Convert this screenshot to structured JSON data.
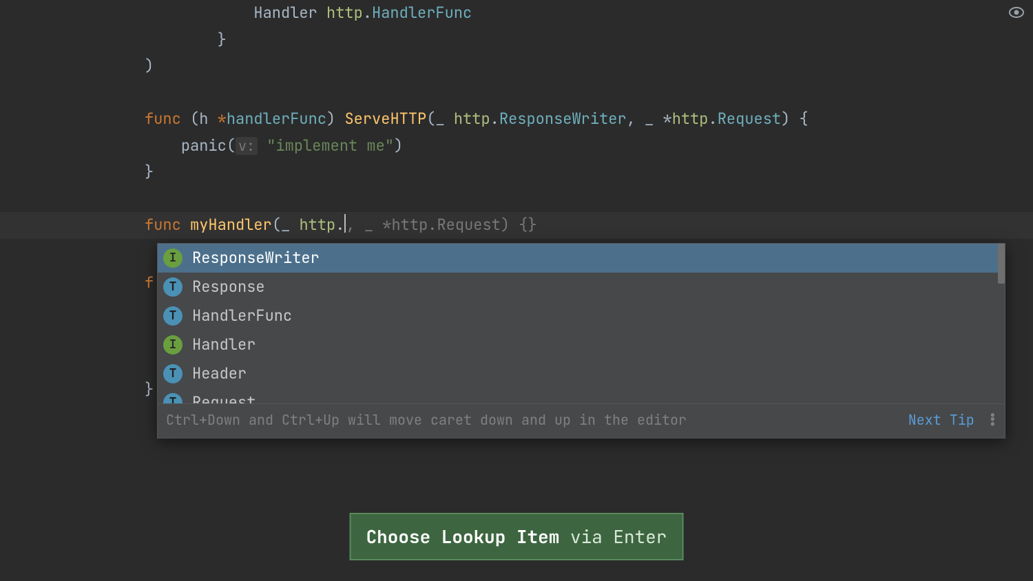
{
  "code": {
    "l1_indent": "            ",
    "l1_field": "Handler ",
    "l1_pkg": "http",
    "l1_dot": ".",
    "l1_type": "HandlerFunc",
    "l2": "        }",
    "l3": ")",
    "l4": "",
    "l5_kw": "func ",
    "l5_p1": "(",
    "l5_recv": "h ",
    "l5_ptr": "*",
    "l5_type1": "handlerFunc",
    "l5_p2": ") ",
    "l5_fn": "ServeHTTP",
    "l5_p3": "(",
    "l5_u1": "_ ",
    "l5_pkg2": "http",
    "l5_dot2": ".",
    "l5_type2": "ResponseWriter",
    "l5_c": ", ",
    "l5_u2": "_ *",
    "l5_pkg3": "http",
    "l5_dot3": ".",
    "l5_type3": "Request",
    "l5_p4": ") {",
    "l6_indent": "    ",
    "l6_panic": "panic",
    "l6_p1": "(",
    "l6_hint": "v:",
    "l6_sp": " ",
    "l6_str": "\"implement me\"",
    "l6_p2": ")",
    "l7": "}",
    "l8": "",
    "l9_kw": "func ",
    "l9_fn": "myHandler",
    "l9_p1": "(",
    "l9_u1": "_ ",
    "l9_pkg": "http",
    "l9_dot": ".",
    "l9_c": ", ",
    "l9_u2": "_ *",
    "l9_pkg2": "http",
    "l9_dot2": ".",
    "l9_type": "Request",
    "l9_p2": ") {}",
    "behind_f": "f",
    "behind_brace": "}"
  },
  "completion": {
    "items": [
      {
        "badge": "I",
        "name": "ResponseWriter",
        "selected": true
      },
      {
        "badge": "T",
        "name": "Response",
        "selected": false
      },
      {
        "badge": "T",
        "name": "HandlerFunc",
        "selected": false
      },
      {
        "badge": "I",
        "name": "Handler",
        "selected": false
      },
      {
        "badge": "T",
        "name": "Header",
        "selected": false
      },
      {
        "badge": "T",
        "name": "Request",
        "selected": false
      }
    ],
    "footer_hint": "Ctrl+Down and Ctrl+Up will move caret down and up in the editor",
    "footer_link": "Next Tip"
  },
  "tooltip": {
    "strong": "Choose Lookup Item",
    "rest": " via Enter"
  }
}
